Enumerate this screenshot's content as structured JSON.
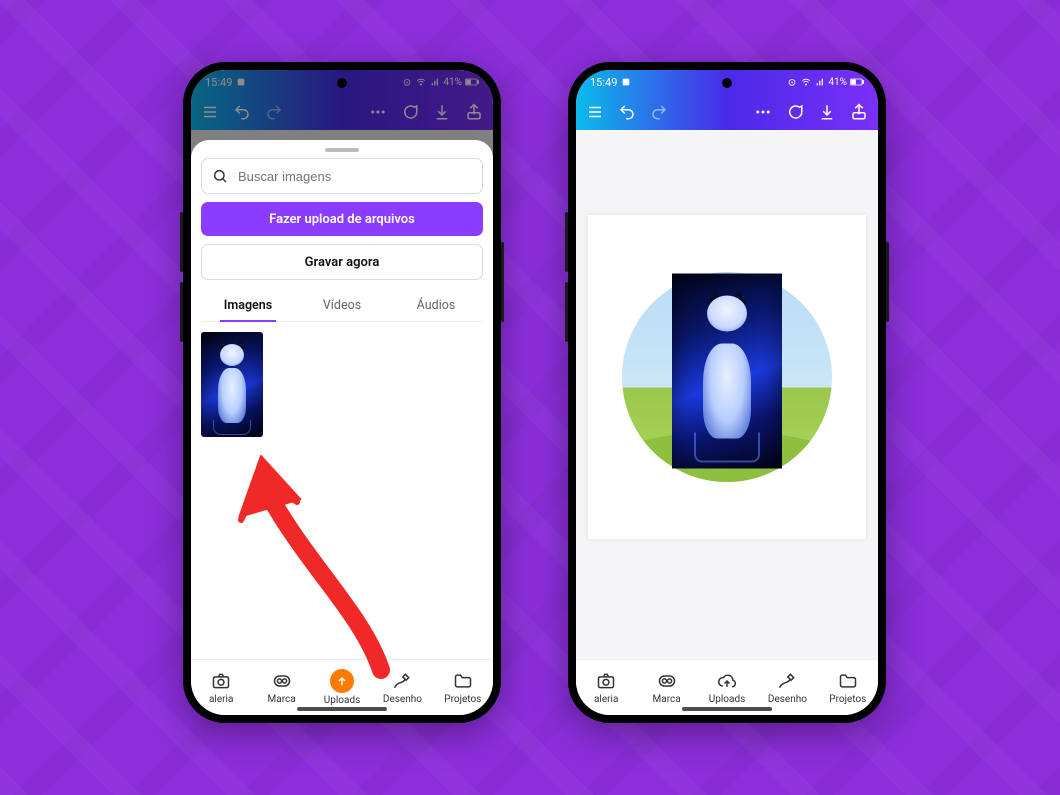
{
  "status": {
    "time": "15:49",
    "battery": "41%"
  },
  "toolbar": {},
  "sheet": {
    "search_placeholder": "Buscar imagens",
    "upload_label": "Fazer upload de arquivos",
    "record_label": "Gravar agora",
    "tabs": {
      "images": "Imagens",
      "videos": "Vídeos",
      "audios": "Áudios"
    }
  },
  "nav": {
    "gallery": "aleria",
    "brand": "Marca",
    "uploads": "Uploads",
    "draw": "Desenho",
    "projects": "Projetos"
  }
}
